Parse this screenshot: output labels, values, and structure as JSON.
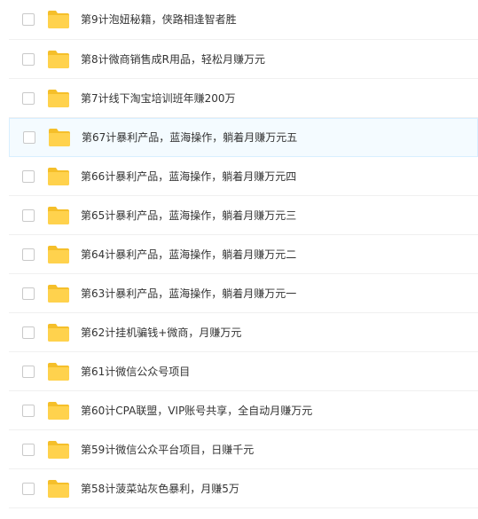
{
  "files": [
    {
      "name": "第9计泡妞秘籍，侠路相逢智者胜",
      "selected": false
    },
    {
      "name": "第8计微商销售成R用品，轻松月赚万元",
      "selected": false
    },
    {
      "name": "第7计线下淘宝培训班年赚200万",
      "selected": false
    },
    {
      "name": "第67计暴利产品，蓝海操作，躺着月赚万元五",
      "selected": false,
      "highlighted": true
    },
    {
      "name": "第66计暴利产品，蓝海操作，躺着月赚万元四",
      "selected": false
    },
    {
      "name": "第65计暴利产品，蓝海操作，躺着月赚万元三",
      "selected": false
    },
    {
      "name": "第64计暴利产品，蓝海操作，躺着月赚万元二",
      "selected": false
    },
    {
      "name": "第63计暴利产品，蓝海操作，躺着月赚万元一",
      "selected": false
    },
    {
      "name": "第62计挂机骗钱+微商，月赚万元",
      "selected": false
    },
    {
      "name": "第61计微信公众号项目",
      "selected": false
    },
    {
      "name": "第60计CPA联盟，VIP账号共享，全自动月赚万元",
      "selected": false
    },
    {
      "name": "第59计微信公众平台项目，日赚千元",
      "selected": false
    },
    {
      "name": "第58计菠菜站灰色暴利，月赚5万",
      "selected": false
    }
  ],
  "colors": {
    "folder": "#ffd24d",
    "folder_tab": "#f5bf2a",
    "highlight_bg": "#f4fbff",
    "text": "#333333"
  },
  "icons": {
    "row_icon": "folder-icon",
    "checkbox": "checkbox"
  }
}
